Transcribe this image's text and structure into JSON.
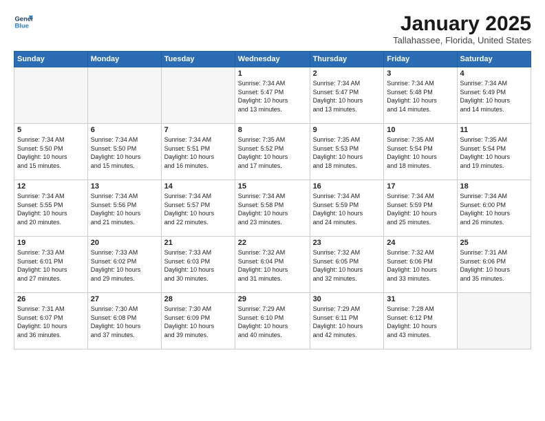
{
  "logo": {
    "line1": "General",
    "line2": "Blue"
  },
  "title": "January 2025",
  "subtitle": "Tallahassee, Florida, United States",
  "days_of_week": [
    "Sunday",
    "Monday",
    "Tuesday",
    "Wednesday",
    "Thursday",
    "Friday",
    "Saturday"
  ],
  "weeks": [
    [
      {
        "num": "",
        "info": ""
      },
      {
        "num": "",
        "info": ""
      },
      {
        "num": "",
        "info": ""
      },
      {
        "num": "1",
        "info": "Sunrise: 7:34 AM\nSunset: 5:47 PM\nDaylight: 10 hours\nand 13 minutes."
      },
      {
        "num": "2",
        "info": "Sunrise: 7:34 AM\nSunset: 5:47 PM\nDaylight: 10 hours\nand 13 minutes."
      },
      {
        "num": "3",
        "info": "Sunrise: 7:34 AM\nSunset: 5:48 PM\nDaylight: 10 hours\nand 14 minutes."
      },
      {
        "num": "4",
        "info": "Sunrise: 7:34 AM\nSunset: 5:49 PM\nDaylight: 10 hours\nand 14 minutes."
      }
    ],
    [
      {
        "num": "5",
        "info": "Sunrise: 7:34 AM\nSunset: 5:50 PM\nDaylight: 10 hours\nand 15 minutes."
      },
      {
        "num": "6",
        "info": "Sunrise: 7:34 AM\nSunset: 5:50 PM\nDaylight: 10 hours\nand 15 minutes."
      },
      {
        "num": "7",
        "info": "Sunrise: 7:34 AM\nSunset: 5:51 PM\nDaylight: 10 hours\nand 16 minutes."
      },
      {
        "num": "8",
        "info": "Sunrise: 7:35 AM\nSunset: 5:52 PM\nDaylight: 10 hours\nand 17 minutes."
      },
      {
        "num": "9",
        "info": "Sunrise: 7:35 AM\nSunset: 5:53 PM\nDaylight: 10 hours\nand 18 minutes."
      },
      {
        "num": "10",
        "info": "Sunrise: 7:35 AM\nSunset: 5:54 PM\nDaylight: 10 hours\nand 18 minutes."
      },
      {
        "num": "11",
        "info": "Sunrise: 7:35 AM\nSunset: 5:54 PM\nDaylight: 10 hours\nand 19 minutes."
      }
    ],
    [
      {
        "num": "12",
        "info": "Sunrise: 7:34 AM\nSunset: 5:55 PM\nDaylight: 10 hours\nand 20 minutes."
      },
      {
        "num": "13",
        "info": "Sunrise: 7:34 AM\nSunset: 5:56 PM\nDaylight: 10 hours\nand 21 minutes."
      },
      {
        "num": "14",
        "info": "Sunrise: 7:34 AM\nSunset: 5:57 PM\nDaylight: 10 hours\nand 22 minutes."
      },
      {
        "num": "15",
        "info": "Sunrise: 7:34 AM\nSunset: 5:58 PM\nDaylight: 10 hours\nand 23 minutes."
      },
      {
        "num": "16",
        "info": "Sunrise: 7:34 AM\nSunset: 5:59 PM\nDaylight: 10 hours\nand 24 minutes."
      },
      {
        "num": "17",
        "info": "Sunrise: 7:34 AM\nSunset: 5:59 PM\nDaylight: 10 hours\nand 25 minutes."
      },
      {
        "num": "18",
        "info": "Sunrise: 7:34 AM\nSunset: 6:00 PM\nDaylight: 10 hours\nand 26 minutes."
      }
    ],
    [
      {
        "num": "19",
        "info": "Sunrise: 7:33 AM\nSunset: 6:01 PM\nDaylight: 10 hours\nand 27 minutes."
      },
      {
        "num": "20",
        "info": "Sunrise: 7:33 AM\nSunset: 6:02 PM\nDaylight: 10 hours\nand 29 minutes."
      },
      {
        "num": "21",
        "info": "Sunrise: 7:33 AM\nSunset: 6:03 PM\nDaylight: 10 hours\nand 30 minutes."
      },
      {
        "num": "22",
        "info": "Sunrise: 7:32 AM\nSunset: 6:04 PM\nDaylight: 10 hours\nand 31 minutes."
      },
      {
        "num": "23",
        "info": "Sunrise: 7:32 AM\nSunset: 6:05 PM\nDaylight: 10 hours\nand 32 minutes."
      },
      {
        "num": "24",
        "info": "Sunrise: 7:32 AM\nSunset: 6:06 PM\nDaylight: 10 hours\nand 33 minutes."
      },
      {
        "num": "25",
        "info": "Sunrise: 7:31 AM\nSunset: 6:06 PM\nDaylight: 10 hours\nand 35 minutes."
      }
    ],
    [
      {
        "num": "26",
        "info": "Sunrise: 7:31 AM\nSunset: 6:07 PM\nDaylight: 10 hours\nand 36 minutes."
      },
      {
        "num": "27",
        "info": "Sunrise: 7:30 AM\nSunset: 6:08 PM\nDaylight: 10 hours\nand 37 minutes."
      },
      {
        "num": "28",
        "info": "Sunrise: 7:30 AM\nSunset: 6:09 PM\nDaylight: 10 hours\nand 39 minutes."
      },
      {
        "num": "29",
        "info": "Sunrise: 7:29 AM\nSunset: 6:10 PM\nDaylight: 10 hours\nand 40 minutes."
      },
      {
        "num": "30",
        "info": "Sunrise: 7:29 AM\nSunset: 6:11 PM\nDaylight: 10 hours\nand 42 minutes."
      },
      {
        "num": "31",
        "info": "Sunrise: 7:28 AM\nSunset: 6:12 PM\nDaylight: 10 hours\nand 43 minutes."
      },
      {
        "num": "",
        "info": ""
      }
    ]
  ]
}
